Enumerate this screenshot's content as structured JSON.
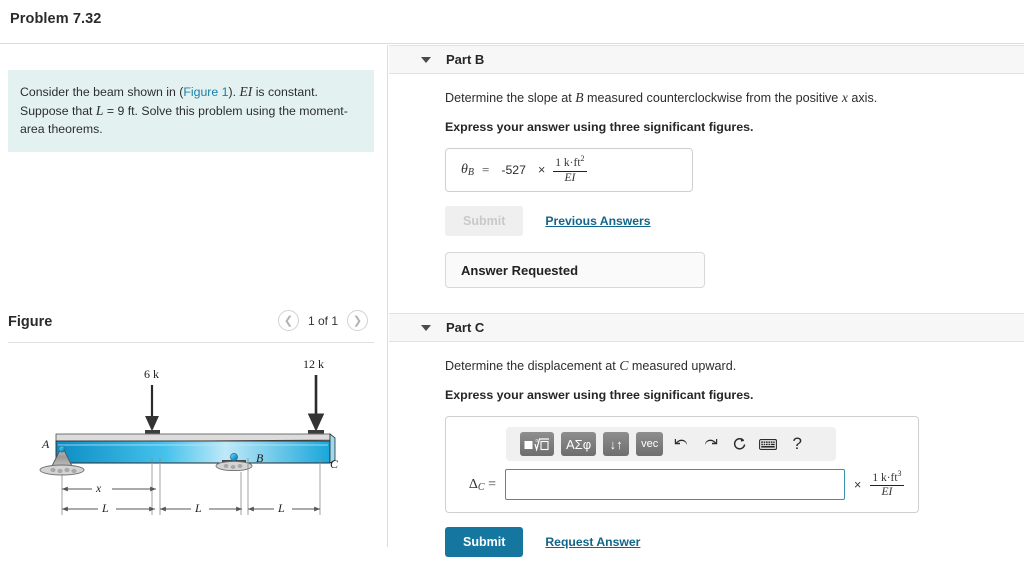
{
  "header": {
    "problem_title": "Problem 7.32"
  },
  "left": {
    "statement": {
      "line1_a": "Consider the beam shown in (",
      "figure_link": "Figure 1",
      "line1_b": "). ",
      "ei": "EI",
      "line1_c": " is constant. Suppose that ",
      "l_sym": "L",
      "line1_d": " = 9 ft. Solve this problem using the moment-area theorems."
    },
    "figure": {
      "title": "Figure",
      "prev_icon": "chevron-left-icon",
      "next_icon": "chevron-right-icon",
      "page_label": "1 of 1",
      "labels": {
        "load_left": "6 k",
        "load_right": "12 k",
        "point_a": "A",
        "point_b": "B",
        "point_c": "C",
        "dim_x": "x",
        "dim_l1": "L",
        "dim_l2": "L",
        "dim_l3": "L"
      },
      "colors": {
        "beam_top": "#cfe9f5",
        "beam_mid": "#1fa9dd",
        "beam_light": "#bfe6f6",
        "beam_dark": "#0d84b8",
        "support": "#8c8c8c"
      }
    }
  },
  "parts": [
    {
      "id": "part-b",
      "caret_icon": "caret-down-icon",
      "label": "Part B",
      "prompt_a": "Determine the slope at ",
      "prompt_sym1": "B",
      "prompt_b": " measured counterclockwise from the positive ",
      "prompt_sym2": "x",
      "prompt_c": " axis.",
      "instruction": "Express your answer using three significant figures.",
      "answer": {
        "symbol": "θ",
        "subscript": "B",
        "equals": "=",
        "value": "-527",
        "times": "×",
        "unit_num_a": "1 k·ft",
        "unit_num_exp": "2",
        "unit_den": "EI"
      },
      "submit_label": "Submit",
      "submit_enabled": false,
      "secondary_link": "Previous Answers",
      "notice": "Answer Requested"
    },
    {
      "id": "part-c",
      "caret_icon": "caret-down-icon",
      "label": "Part C",
      "prompt_a": "Determine the displacement at ",
      "prompt_sym1": "C",
      "prompt_b": " measured upward.",
      "instruction": "Express your answer using three significant figures.",
      "toolbar": [
        {
          "name": "template-root-button",
          "glyph": "▪√▫"
        },
        {
          "name": "greek-symbols-button",
          "glyph": "ΑΣφ"
        },
        {
          "name": "arrows-button",
          "glyph": "↓↑"
        },
        {
          "name": "vector-button",
          "glyph": "vec"
        },
        {
          "name": "undo-button",
          "glyph": "↰"
        },
        {
          "name": "redo-button",
          "glyph": "↱"
        },
        {
          "name": "reset-button",
          "glyph": "↺"
        },
        {
          "name": "keyboard-button",
          "glyph": "⌨"
        },
        {
          "name": "help-button",
          "glyph": "?"
        }
      ],
      "answer": {
        "symbol": "Δ",
        "subscript": "C",
        "equals": "=",
        "value": "",
        "placeholder": "",
        "times": "×",
        "unit_num_a": "1 k·ft",
        "unit_num_exp": "3",
        "unit_den": "EI"
      },
      "submit_label": "Submit",
      "submit_enabled": true,
      "secondary_link": "Request Answer"
    }
  ],
  "colors": {
    "accent": "#1577a0",
    "link": "#12658a",
    "statement_bg": "#e3f2f1",
    "panel_bg": "#f7f7f7"
  }
}
